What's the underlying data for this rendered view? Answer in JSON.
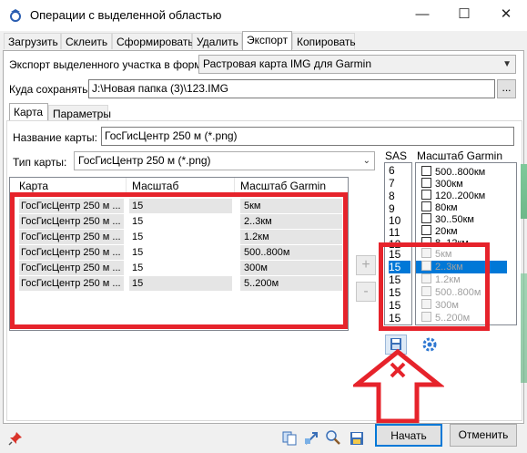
{
  "window": {
    "title": "Операции с выделенной областью",
    "minimize_icon": "minimize-icon",
    "maximize_icon": "maximize-icon",
    "close_icon": "close-icon"
  },
  "main_tabs": [
    {
      "label": "Загрузить"
    },
    {
      "label": "Склеить"
    },
    {
      "label": "Сформировать"
    },
    {
      "label": "Удалить"
    },
    {
      "label": "Экспорт",
      "active": true
    },
    {
      "label": "Копировать"
    }
  ],
  "export_format": {
    "label": "Экспорт выделенного участка в формат",
    "value": "Растровая карта IMG для Garmin"
  },
  "save_to": {
    "label": "Куда сохранять:",
    "value": "J:\\Новая папка (3)\\123.IMG",
    "browse_label": "..."
  },
  "sub_tabs": [
    {
      "label": "Карта",
      "active": true
    },
    {
      "label": "Параметры"
    }
  ],
  "map_name": {
    "label": "Название карты:",
    "value": "ГосГисЦентр 250 м (*.png)"
  },
  "map_type": {
    "label": "Тип карты:",
    "value": "ГосГисЦентр 250 м (*.png)"
  },
  "grid": {
    "columns": [
      "Карта",
      "Масштаб",
      "Масштаб Garmin"
    ],
    "rows": [
      [
        "ГосГисЦентр 250 м ...",
        "15",
        "5км"
      ],
      [
        "ГосГисЦентр 250 м ...",
        "15",
        "2..3км"
      ],
      [
        "ГосГисЦентр 250 м ...",
        "15",
        "1.2км"
      ],
      [
        "ГосГисЦентр 250 м ...",
        "15",
        "500..800м"
      ],
      [
        "ГосГисЦентр 250 м ...",
        "15",
        "300м"
      ],
      [
        "ГосГисЦентр 250 м ...",
        "15",
        "5..200м"
      ]
    ]
  },
  "add_button": "+",
  "remove_button": "-",
  "sas": {
    "label": "SAS",
    "items": [
      "6",
      "7",
      "8",
      "9",
      "10",
      "11",
      "12",
      "",
      "15",
      "15",
      "15",
      "15",
      "15",
      "15"
    ],
    "selected_index": 9
  },
  "garmin": {
    "label": "Масштаб Garmin",
    "items": [
      {
        "text": "500..800км",
        "enabled": true
      },
      {
        "text": "300км",
        "enabled": true
      },
      {
        "text": "120..200км",
        "enabled": true
      },
      {
        "text": "80км",
        "enabled": true
      },
      {
        "text": "30..50км",
        "enabled": true
      },
      {
        "text": "20км",
        "enabled": true
      },
      {
        "text": "8..12км",
        "enabled": true
      },
      {
        "text": "",
        "enabled": true
      },
      {
        "text": "5км",
        "enabled": false
      },
      {
        "text": "2..3км",
        "enabled": false,
        "selected": true
      },
      {
        "text": "1.2км",
        "enabled": false
      },
      {
        "text": "500..800м",
        "enabled": false
      },
      {
        "text": "300м",
        "enabled": false
      },
      {
        "text": "5..200м",
        "enabled": false
      }
    ]
  },
  "bottom": {
    "start_label": "Начать",
    "cancel_label": "Отменить"
  },
  "colors": {
    "annotation_red": "#e6232b",
    "selection_blue": "#0078d7"
  }
}
